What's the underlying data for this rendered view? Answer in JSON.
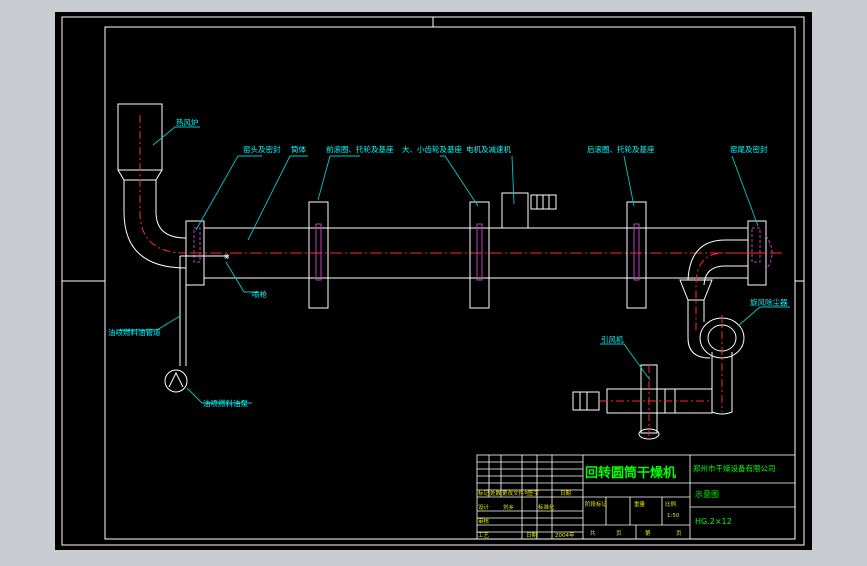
{
  "colors": {
    "background": "#000000",
    "frame": "#ffffff",
    "leader": "#00c8c8",
    "label": "#00ffff",
    "centerline": "#ff2a2a",
    "title": "#00ff00",
    "table_text": "#e8e800"
  },
  "labels": {
    "hot_air_furnace": "热风炉",
    "head_seal": "窑头及密封",
    "drum": "筒体",
    "front_ring": "前滚圈、托轮及基座",
    "gear": "大、小齿轮及基座",
    "motor_reducer": "电机及减速机",
    "rear_ring": "后滚圈、托轮及基座",
    "tail_seal": "窑尾及密封",
    "cyclone": "旋风除尘器",
    "fan": "引风机",
    "burner": "喷枪",
    "fuel_pipe": "油喷燃料油管道",
    "fuel_pump": "油喷燃料油泵"
  },
  "title_block": {
    "product_name": "回转圆筒干燥机",
    "company": "郑州市干燥设备有限公司",
    "drawing_type": "示意图",
    "model": "HG.2×12",
    "scale": "1:50",
    "row_headers": [
      "标记",
      "处数",
      "更改文件号",
      "签字",
      "日期"
    ],
    "role_rows": [
      "设计",
      "审核",
      "工艺"
    ],
    "designer_hint": "刘乡",
    "date_hint": "日期",
    "std_label": "标准化",
    "date_value": "2004年",
    "stage_label": "阶段标记",
    "weight_label": "重量",
    "ratio_label": "比例",
    "sheet_total": "共",
    "sheet_unit": "页",
    "sheet_no": "第",
    "sheet_unit2": "页"
  }
}
